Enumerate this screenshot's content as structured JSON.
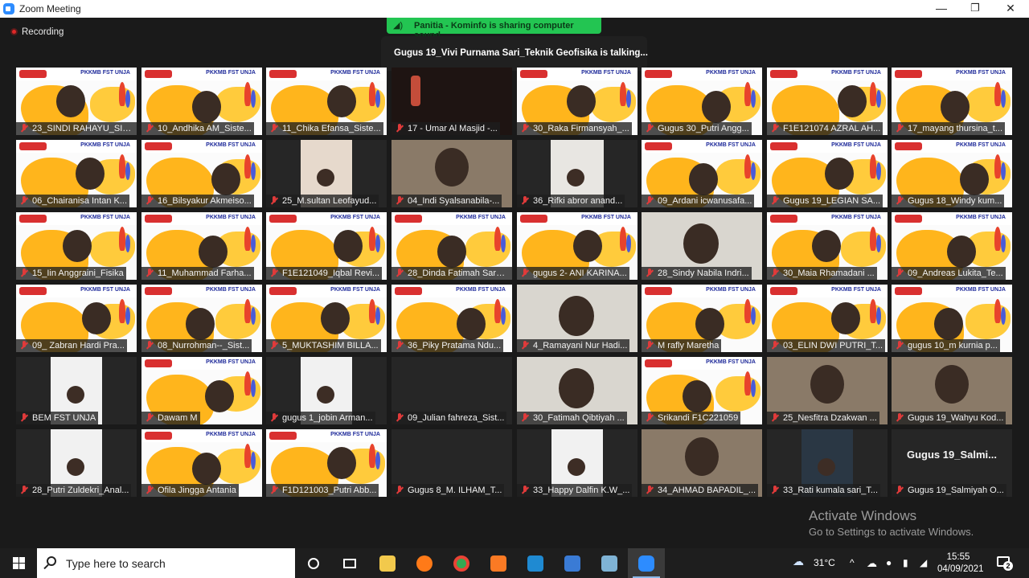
{
  "window": {
    "title": "Zoom Meeting",
    "minimize": "—",
    "restore": "❐",
    "close": "✕"
  },
  "share_banner": "Panitia - Kominfo is sharing computer sound",
  "talking": "Gugus 19_Vivi Purnama Sari_Teknik Geofisika is talking...",
  "recording": "Recording",
  "tile_brand": "PKKMB FST UNJA",
  "participants": [
    "23_SINDI RAHAYU_SIS...",
    "10_Andhika AM_Siste...",
    "11_Chika Efansa_Siste...",
    "17 - Umar Al Masjid -...",
    "30_Raka Firmansyah_...",
    "Gugus 30_Putri Angg...",
    "F1E121074 AZRAL AH...",
    "17_mayang thursina_t...",
    "06_Chairanisa Intan K...",
    "16_Bilsyakur Akmeiso...",
    "25_M.sultan Leofayud...",
    "04_Indi Syalsanabila-...",
    "36_Rifki abror anand...",
    "09_Ardani icwanusafa...",
    "Gugus 19_LEGIAN SA...",
    "Gugus 18_Windy kum...",
    "15_Iin Anggraini_Fisika",
    "11_Muhammad Farha...",
    "F1E121049_Iqbal Revi...",
    "28_Dinda Fatimah Sarah_...",
    "gugus 2- ANI KARINA...",
    "28_Sindy Nabila Indri...",
    "30_Maia Rhamadani ...",
    "09_Andreas Lukita_Te...",
    "09_ Zabran Hardi Pra...",
    "08_Nurrohman--_Sist...",
    "5_MUKTASHIM BILLA...",
    "36_Piky Pratama Ndu...",
    "4_Ramayani Nur Hadi...",
    "M rafly Maretha",
    "03_ELIN DWI PUTRI_T...",
    "gugus 10_m kurnia p...",
    "BEM FST UNJA",
    "Dawam M",
    "gugus 1_jobin Arman...",
    "09_Julian fahreza_Sist...",
    "30_Fatimah Qibtiyah ...",
    "Srikandi F1C221059",
    "25_Nesfitra Dzakwan ...",
    "Gugus 19_Wahyu Kod...",
    "28_Putri Zuldekri_Anal...",
    "Ofila Jingga Antania",
    "F1D121003_Putri Abb...",
    "Gugus 8_M. ILHAM_T...",
    "33_Happy Dalfin K.W_...",
    "34_AHMAD BAPADIL_...",
    "33_Rati kumala sari_T...",
    "Gugus 19_Salmiyah O..."
  ],
  "big_name": "Gugus  19_Salmi...",
  "activate": {
    "title": "Activate Windows",
    "subtitle": "Go to Settings to activate Windows."
  },
  "taskbar": {
    "search_placeholder": "Type here to search",
    "weather": "31°C",
    "time": "15:55",
    "date": "04/09/2021",
    "notifications": "2"
  },
  "colors": {
    "share_green": "#23c552",
    "poster_yellow": "#ffb51c",
    "zoom_blue": "#2d8cff",
    "muted_red": "#e03a3a"
  }
}
